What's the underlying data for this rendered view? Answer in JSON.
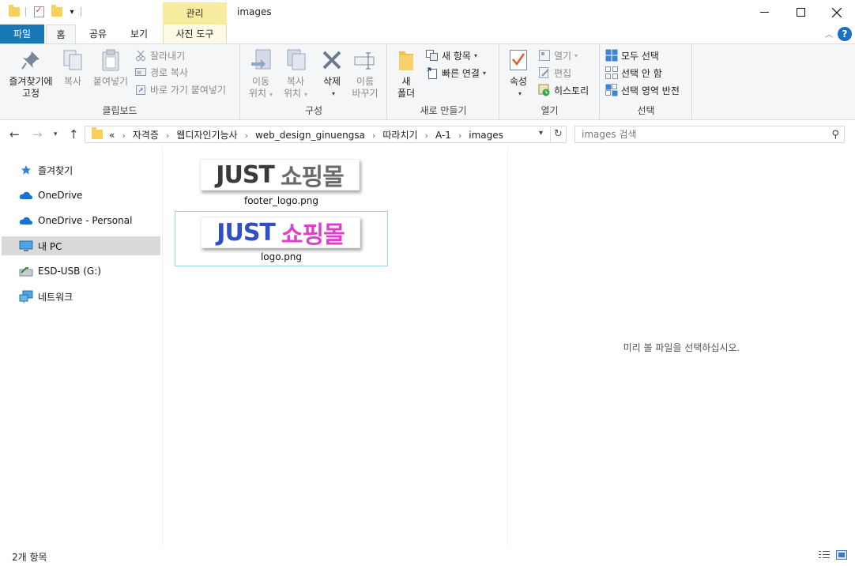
{
  "window": {
    "title": "images",
    "context_tab_header": "관리"
  },
  "tabs": {
    "file": "파일",
    "home": "홈",
    "share": "공유",
    "view": "보기",
    "photo_tools": "사진 도구"
  },
  "ribbon": {
    "clipboard": {
      "label": "클립보드",
      "pin_line1": "즐겨찾기에",
      "pin_line2": "고정",
      "copy": "복사",
      "paste": "붙여넣기",
      "cut": "잘라내기",
      "copy_path": "경로 복사",
      "paste_shortcut": "바로 가기 붙여넣기"
    },
    "organize": {
      "label": "구성",
      "move_line1": "이동",
      "move_line2": "위치",
      "copyto_line1": "복사",
      "copyto_line2": "위치",
      "delete": "삭제",
      "rename_line1": "이름",
      "rename_line2": "바꾸기"
    },
    "new": {
      "label": "새로 만들기",
      "folder_line1": "새",
      "folder_line2": "폴더",
      "new_item": "새 항목",
      "easy_access": "빠른 연결"
    },
    "open": {
      "label": "열기",
      "properties": "속성",
      "open": "열기",
      "edit": "편집",
      "history": "히스토리"
    },
    "select": {
      "label": "선택",
      "select_all": "모두 선택",
      "select_none": "선택 안 함",
      "invert": "선택 영역 반전"
    }
  },
  "address": {
    "crumbs": [
      "«",
      "자격증",
      "웹디자인기능사",
      "web_design_ginuengsa",
      "따라치기",
      "A-1",
      "images"
    ],
    "search_placeholder": "images 검색"
  },
  "nav": {
    "items": [
      "즐겨찾기",
      "OneDrive",
      "OneDrive - Personal",
      "내 PC",
      "ESD-USB (G:)",
      "네트워크"
    ],
    "selected_index": 3
  },
  "files": [
    {
      "name": "footer_logo.png",
      "thumb_text_a": "JUST",
      "thumb_text_b": "쇼핑몰",
      "color_a": "#3a3a3a",
      "color_b": "#6a6a6a"
    },
    {
      "name": "logo.png",
      "thumb_text_a": "JUST",
      "thumb_text_b": "쇼핑몰",
      "color_a": "#2f4fc8",
      "color_b": "#e040c8"
    }
  ],
  "preview": {
    "message": "미리 볼 파일을 선택하십시오."
  },
  "status": {
    "count": "2개 항목"
  },
  "colors": {
    "file_tab": "#1979b7",
    "manage_tab": "#f8ec9e",
    "selection_border": "#99d1e6",
    "nav_selected": "#d9d9d9"
  }
}
